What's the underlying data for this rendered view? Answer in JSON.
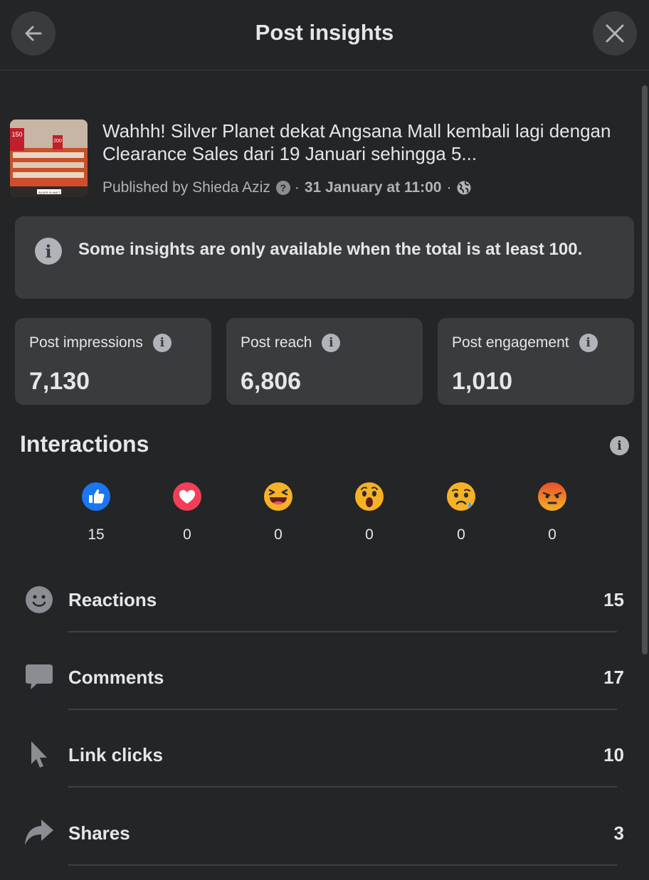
{
  "header": {
    "title": "Post insights",
    "back_icon": "arrow-left-icon",
    "close_icon": "close-icon"
  },
  "post": {
    "text": "Wahhh! Silver Planet dekat Angsana Mall kembali lagi dengan Clearance Sales dari 19 Januari sehingga 5...",
    "published_by": "Published by Shieda Aziz",
    "help_badge": "?",
    "separator": "·",
    "date": "31 January at 11:00",
    "audience_icon": "globe-icon",
    "thumbnail_sign_left": "150",
    "thumbnail_sign_right": "200",
    "thumbnail_banner": "SILVER PLANET"
  },
  "notice": {
    "icon": "i",
    "text": "Some insights are only available when the total is at least 100."
  },
  "stats": [
    {
      "label": "Post impressions",
      "value": "7,130"
    },
    {
      "label": "Post reach",
      "value": "6,806"
    },
    {
      "label": "Post engagement",
      "value": "1,010"
    }
  ],
  "info_glyph": "i",
  "interactions": {
    "title": "Interactions",
    "reactions": [
      {
        "name": "like",
        "count": "15"
      },
      {
        "name": "love",
        "count": "0"
      },
      {
        "name": "haha",
        "count": "0"
      },
      {
        "name": "wow",
        "count": "0"
      },
      {
        "name": "sad",
        "count": "0"
      },
      {
        "name": "angry",
        "count": "0"
      }
    ]
  },
  "metrics": [
    {
      "label": "Reactions",
      "value": "15",
      "icon": "smiley-icon"
    },
    {
      "label": "Comments",
      "value": "17",
      "icon": "comment-icon"
    },
    {
      "label": "Link clicks",
      "value": "10",
      "icon": "cursor-icon"
    },
    {
      "label": "Shares",
      "value": "3",
      "icon": "share-icon"
    }
  ],
  "colors": {
    "background": "#242526",
    "card": "#3a3b3c",
    "text": "#e4e6eb",
    "secondary_text": "#b0b3b8",
    "like_blue": "#1877f2",
    "love_red": "#f33e58"
  }
}
